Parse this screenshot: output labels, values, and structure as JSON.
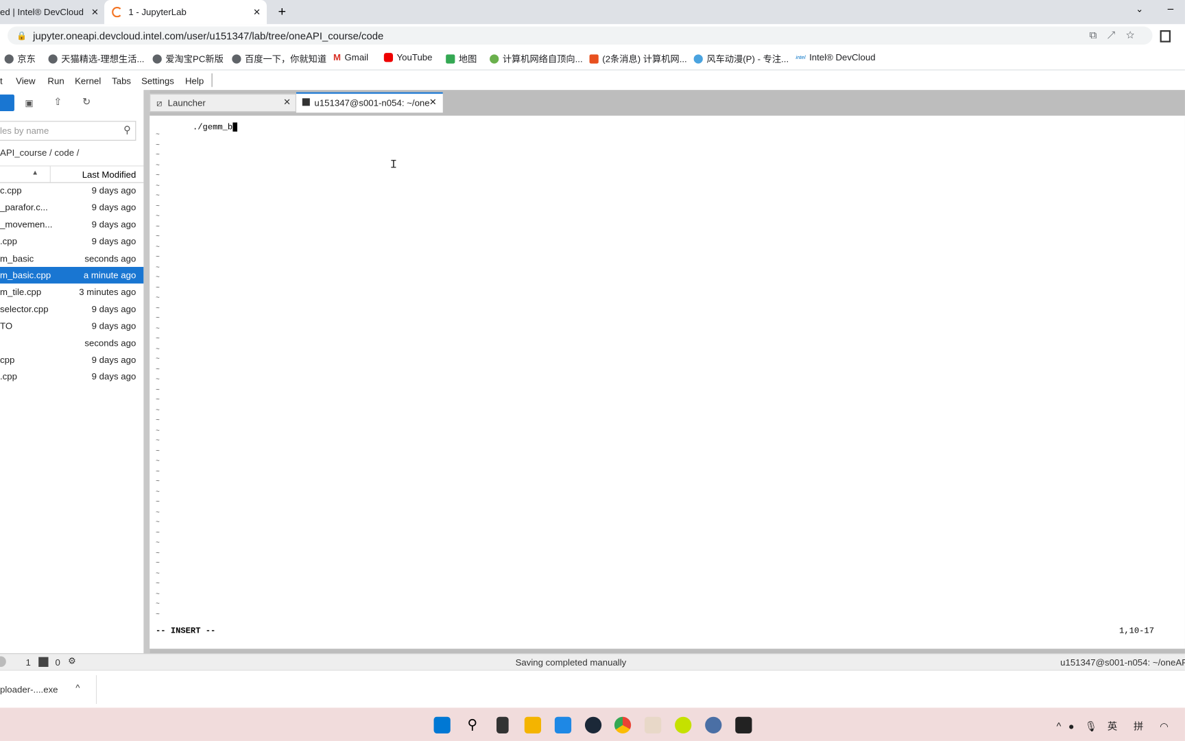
{
  "browser": {
    "tabs": [
      {
        "label": "ed | Intel® DevCloud"
      },
      {
        "label": "1 - JupyterLab"
      }
    ],
    "url": "jupyter.oneapi.devcloud.intel.com/user/u151347/lab/tree/oneAPI_course/code",
    "bookmarks": [
      "京东",
      "天猫精选-理想生活...",
      "爱淘宝PC新版",
      "百度一下，你就知道",
      "Gmail",
      "YouTube",
      "地图",
      "计算机网络自顶向...",
      "(2条消息) 计算机网...",
      "风车动漫(P) - 专注...",
      "Intel® DevCloud"
    ]
  },
  "menu": [
    "t",
    "View",
    "Run",
    "Kernel",
    "Tabs",
    "Settings",
    "Help"
  ],
  "filebrowser": {
    "search_placeholder": "les by name",
    "breadcrumb": "API_course / code /",
    "col_modified": "Last Modified",
    "files": [
      {
        "name": "c.cpp",
        "modified": "9 days ago"
      },
      {
        "name": "_parafor.c...",
        "modified": "9 days ago"
      },
      {
        "name": "_movemen...",
        "modified": "9 days ago"
      },
      {
        "name": ".cpp",
        "modified": "9 days ago"
      },
      {
        "name": "m_basic",
        "modified": "seconds ago"
      },
      {
        "name": "m_basic.cpp",
        "modified": "a minute ago",
        "selected": true
      },
      {
        "name": "m_tile.cpp",
        "modified": "3 minutes ago"
      },
      {
        "name": "selector.cpp",
        "modified": "9 days ago"
      },
      {
        "name": "TO",
        "modified": "9 days ago"
      },
      {
        "name": "",
        "modified": "seconds ago"
      },
      {
        "name": "cpp",
        "modified": "9 days ago"
      },
      {
        "name": ".cpp",
        "modified": "9 days ago"
      }
    ]
  },
  "doc_tabs": [
    {
      "label": "Launcher"
    },
    {
      "label": "u151347@s001-n054: ~/one"
    }
  ],
  "terminal": {
    "line1": "./gemm_b",
    "mode": "-- INSERT --",
    "position": "1,10-17"
  },
  "statusbar": {
    "kernels": "1",
    "terminals": "0",
    "message": "Saving completed manually",
    "right": "u151347@s001-n054: ~/oneAPI"
  },
  "download": {
    "file": "ploader-....exe"
  },
  "tray": {
    "ime1": "英",
    "ime2": "拼"
  }
}
